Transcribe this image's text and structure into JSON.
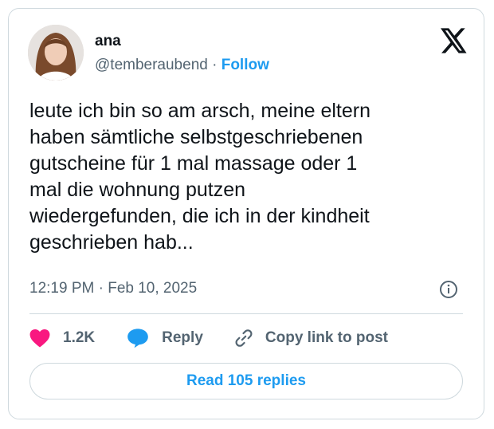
{
  "author": {
    "name": "ana",
    "handle": "@temberaubend",
    "separator": "·",
    "follow_label": "Follow",
    "avatar_icon": "profile-photo"
  },
  "platform_icon": "x-logo",
  "tweet": {
    "lines": [
      "leute ich bin so am arsch, meine eltern",
      "haben sämtliche selbstgeschriebenen",
      "gutscheine für 1 mal massage oder 1",
      "mal die wohnung putzen",
      "wiedergefunden, die ich in der kindheit",
      "geschrieben hab..."
    ]
  },
  "meta": {
    "timestamp": "12:19 PM · Feb 10, 2025",
    "info_icon": "info-icon"
  },
  "actions": {
    "like_count": "1.2K",
    "reply_label": "Reply",
    "copy_label": "Copy link to post"
  },
  "read_replies_label": "Read 105 replies",
  "colors": {
    "accent": "#1d9bf0",
    "like": "#f91880",
    "text": "#0f1419",
    "muted": "#536471",
    "border": "#cfd9de"
  }
}
